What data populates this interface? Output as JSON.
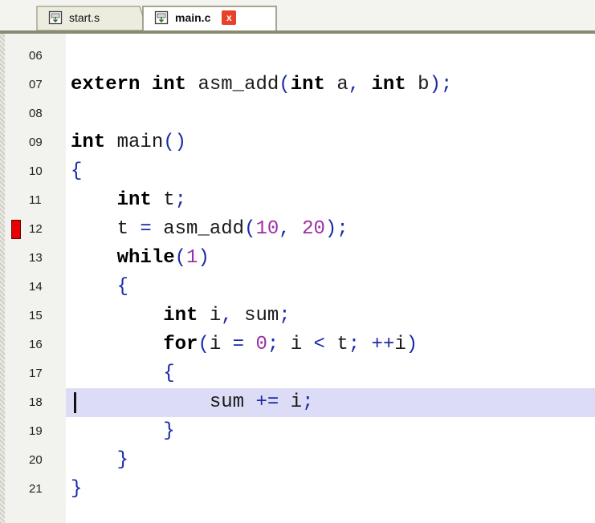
{
  "tabs": [
    {
      "label": "start.s",
      "active": false
    },
    {
      "label": "main.c",
      "active": true,
      "close_label": "x"
    }
  ],
  "editor": {
    "current_line": "18",
    "breakpoint_line": "12",
    "lines": [
      {
        "number": "06",
        "code": ""
      },
      {
        "number": "07",
        "code": "extern int asm_add(int a, int b);"
      },
      {
        "number": "08",
        "code": ""
      },
      {
        "number": "09",
        "code": "int main()"
      },
      {
        "number": "10",
        "code": "{"
      },
      {
        "number": "11",
        "code": "    int t;"
      },
      {
        "number": "12",
        "code": "    t = asm_add(10, 20);"
      },
      {
        "number": "13",
        "code": "    while(1)"
      },
      {
        "number": "14",
        "code": "    {"
      },
      {
        "number": "15",
        "code": "        int i, sum;"
      },
      {
        "number": "16",
        "code": "        for(i = 0; i < t; ++i)"
      },
      {
        "number": "17",
        "code": "        {"
      },
      {
        "number": "18",
        "code": "            sum += i;"
      },
      {
        "number": "19",
        "code": "        }"
      },
      {
        "number": "20",
        "code": "    }"
      },
      {
        "number": "21",
        "code": "}"
      }
    ]
  },
  "syntax": {
    "keywords": [
      "extern",
      "int",
      "while",
      "for"
    ],
    "number_color": "#9b2fa3",
    "punct_color": "#1b2aa8",
    "current_line_color": "#dcdcf6",
    "breakpoint_color": "#e60000"
  }
}
